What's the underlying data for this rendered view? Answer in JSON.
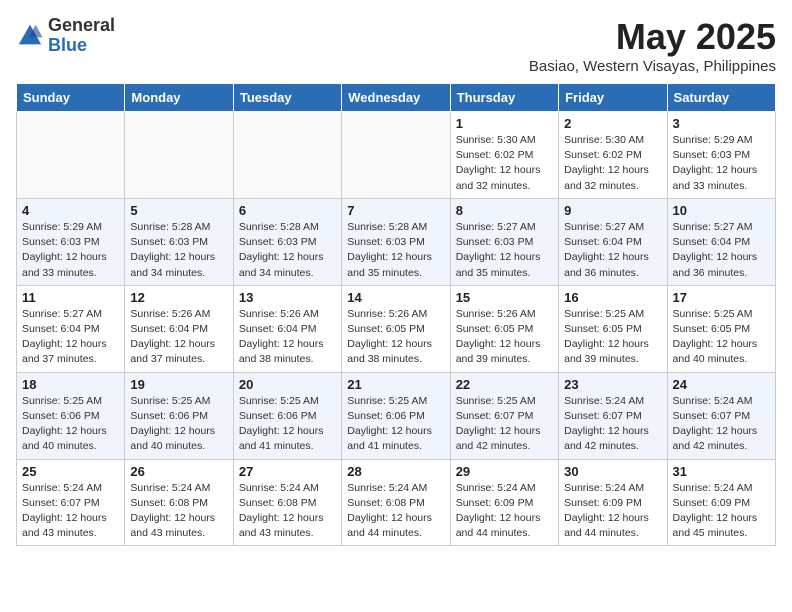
{
  "header": {
    "logo_general": "General",
    "logo_blue": "Blue",
    "month": "May 2025",
    "location": "Basiao, Western Visayas, Philippines"
  },
  "weekdays": [
    "Sunday",
    "Monday",
    "Tuesday",
    "Wednesday",
    "Thursday",
    "Friday",
    "Saturday"
  ],
  "weeks": [
    [
      {
        "day": "",
        "info": ""
      },
      {
        "day": "",
        "info": ""
      },
      {
        "day": "",
        "info": ""
      },
      {
        "day": "",
        "info": ""
      },
      {
        "day": "1",
        "info": "Sunrise: 5:30 AM\nSunset: 6:02 PM\nDaylight: 12 hours\nand 32 minutes."
      },
      {
        "day": "2",
        "info": "Sunrise: 5:30 AM\nSunset: 6:02 PM\nDaylight: 12 hours\nand 32 minutes."
      },
      {
        "day": "3",
        "info": "Sunrise: 5:29 AM\nSunset: 6:03 PM\nDaylight: 12 hours\nand 33 minutes."
      }
    ],
    [
      {
        "day": "4",
        "info": "Sunrise: 5:29 AM\nSunset: 6:03 PM\nDaylight: 12 hours\nand 33 minutes."
      },
      {
        "day": "5",
        "info": "Sunrise: 5:28 AM\nSunset: 6:03 PM\nDaylight: 12 hours\nand 34 minutes."
      },
      {
        "day": "6",
        "info": "Sunrise: 5:28 AM\nSunset: 6:03 PM\nDaylight: 12 hours\nand 34 minutes."
      },
      {
        "day": "7",
        "info": "Sunrise: 5:28 AM\nSunset: 6:03 PM\nDaylight: 12 hours\nand 35 minutes."
      },
      {
        "day": "8",
        "info": "Sunrise: 5:27 AM\nSunset: 6:03 PM\nDaylight: 12 hours\nand 35 minutes."
      },
      {
        "day": "9",
        "info": "Sunrise: 5:27 AM\nSunset: 6:04 PM\nDaylight: 12 hours\nand 36 minutes."
      },
      {
        "day": "10",
        "info": "Sunrise: 5:27 AM\nSunset: 6:04 PM\nDaylight: 12 hours\nand 36 minutes."
      }
    ],
    [
      {
        "day": "11",
        "info": "Sunrise: 5:27 AM\nSunset: 6:04 PM\nDaylight: 12 hours\nand 37 minutes."
      },
      {
        "day": "12",
        "info": "Sunrise: 5:26 AM\nSunset: 6:04 PM\nDaylight: 12 hours\nand 37 minutes."
      },
      {
        "day": "13",
        "info": "Sunrise: 5:26 AM\nSunset: 6:04 PM\nDaylight: 12 hours\nand 38 minutes."
      },
      {
        "day": "14",
        "info": "Sunrise: 5:26 AM\nSunset: 6:05 PM\nDaylight: 12 hours\nand 38 minutes."
      },
      {
        "day": "15",
        "info": "Sunrise: 5:26 AM\nSunset: 6:05 PM\nDaylight: 12 hours\nand 39 minutes."
      },
      {
        "day": "16",
        "info": "Sunrise: 5:25 AM\nSunset: 6:05 PM\nDaylight: 12 hours\nand 39 minutes."
      },
      {
        "day": "17",
        "info": "Sunrise: 5:25 AM\nSunset: 6:05 PM\nDaylight: 12 hours\nand 40 minutes."
      }
    ],
    [
      {
        "day": "18",
        "info": "Sunrise: 5:25 AM\nSunset: 6:06 PM\nDaylight: 12 hours\nand 40 minutes."
      },
      {
        "day": "19",
        "info": "Sunrise: 5:25 AM\nSunset: 6:06 PM\nDaylight: 12 hours\nand 40 minutes."
      },
      {
        "day": "20",
        "info": "Sunrise: 5:25 AM\nSunset: 6:06 PM\nDaylight: 12 hours\nand 41 minutes."
      },
      {
        "day": "21",
        "info": "Sunrise: 5:25 AM\nSunset: 6:06 PM\nDaylight: 12 hours\nand 41 minutes."
      },
      {
        "day": "22",
        "info": "Sunrise: 5:25 AM\nSunset: 6:07 PM\nDaylight: 12 hours\nand 42 minutes."
      },
      {
        "day": "23",
        "info": "Sunrise: 5:24 AM\nSunset: 6:07 PM\nDaylight: 12 hours\nand 42 minutes."
      },
      {
        "day": "24",
        "info": "Sunrise: 5:24 AM\nSunset: 6:07 PM\nDaylight: 12 hours\nand 42 minutes."
      }
    ],
    [
      {
        "day": "25",
        "info": "Sunrise: 5:24 AM\nSunset: 6:07 PM\nDaylight: 12 hours\nand 43 minutes."
      },
      {
        "day": "26",
        "info": "Sunrise: 5:24 AM\nSunset: 6:08 PM\nDaylight: 12 hours\nand 43 minutes."
      },
      {
        "day": "27",
        "info": "Sunrise: 5:24 AM\nSunset: 6:08 PM\nDaylight: 12 hours\nand 43 minutes."
      },
      {
        "day": "28",
        "info": "Sunrise: 5:24 AM\nSunset: 6:08 PM\nDaylight: 12 hours\nand 44 minutes."
      },
      {
        "day": "29",
        "info": "Sunrise: 5:24 AM\nSunset: 6:09 PM\nDaylight: 12 hours\nand 44 minutes."
      },
      {
        "day": "30",
        "info": "Sunrise: 5:24 AM\nSunset: 6:09 PM\nDaylight: 12 hours\nand 44 minutes."
      },
      {
        "day": "31",
        "info": "Sunrise: 5:24 AM\nSunset: 6:09 PM\nDaylight: 12 hours\nand 45 minutes."
      }
    ]
  ]
}
